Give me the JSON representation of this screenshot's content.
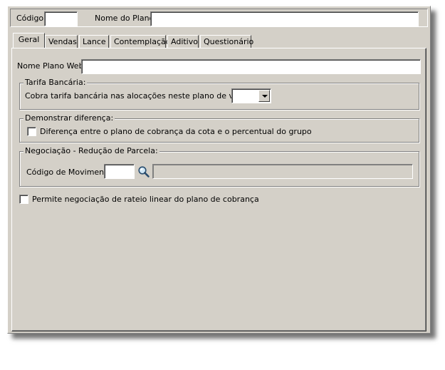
{
  "header": {
    "codigo_label": "Código:",
    "codigo_value": "",
    "nome_plano_label": "Nome do Plano:",
    "nome_plano_value": ""
  },
  "tabs": [
    {
      "label": "Geral",
      "active": true
    },
    {
      "label": "Vendas"
    },
    {
      "label": "Lance"
    },
    {
      "label": "Contemplação"
    },
    {
      "label": "Aditivo"
    },
    {
      "label": "Questionário"
    }
  ],
  "geral": {
    "nome_plano_web_label": "Nome Plano Web:",
    "nome_plano_web_value": "",
    "tarifa": {
      "legend": "Tarifa Bancária:",
      "label": "Cobra tarifa bancária nas alocações neste plano de venda:",
      "selected": ""
    },
    "demonstrar": {
      "legend": "Demonstrar diferença:",
      "checkbox_label": "Diferença entre o plano de cobrança da cota e o percentual do grupo",
      "checked": false
    },
    "negociacao": {
      "legend": "Negociação - Redução de Parcela:",
      "codigo_mov_label": "Código de Movimento:",
      "codigo_mov_value": "",
      "descricao_value": ""
    },
    "rateio_checkbox_label": "Permite negociação de rateio linear do plano de cobrança",
    "rateio_checked": false
  },
  "icons": {
    "search": "search-icon"
  }
}
